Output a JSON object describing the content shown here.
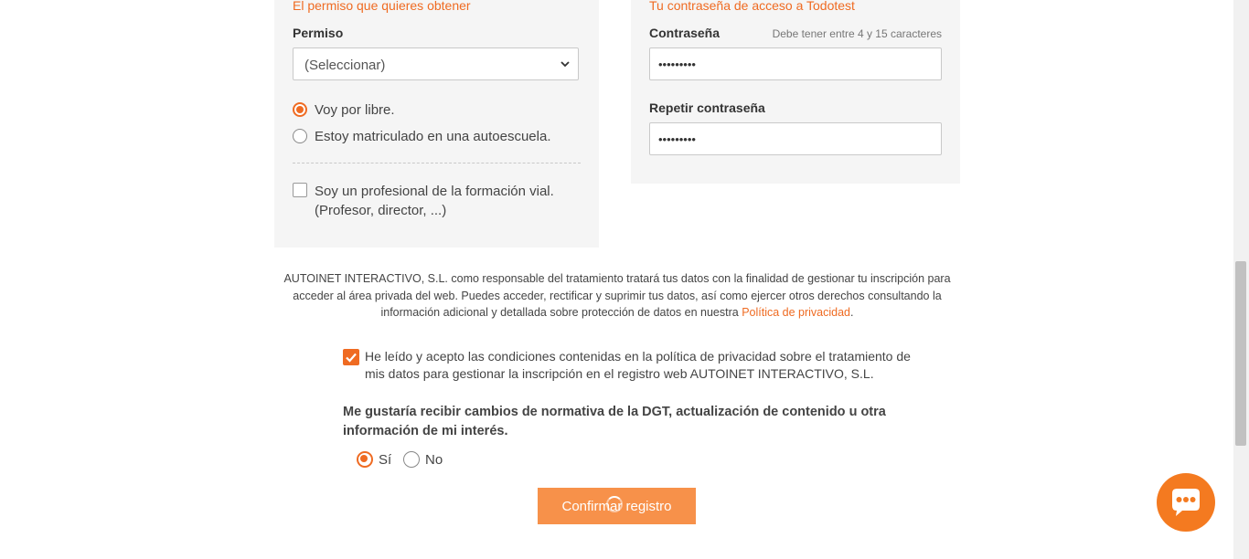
{
  "left_section": {
    "title": "El permiso que quieres obtener",
    "permiso_label": "Permiso",
    "permiso_select_value": "(Seleccionar)",
    "option_libre": "Voy por libre.",
    "option_autoescuela": "Estoy matriculado en una autoescuela.",
    "professional_line1": "Soy un profesional de la formación vial.",
    "professional_line2": "(Profesor, director, ...)"
  },
  "right_section": {
    "title": "Tu contraseña de acceso a Todotest",
    "password_label": "Contraseña",
    "password_hint": "Debe tener entre 4 y 15 caracteres",
    "password_value": "•••••••••",
    "repeat_label": "Repetir contraseña",
    "repeat_value": "•••••••••"
  },
  "privacy": {
    "text": "AUTOINET INTERACTIVO, S.L. como responsable del tratamiento tratará tus datos con la finalidad de gestionar tu inscripción para acceder al área privada del web. Puedes acceder, rectificar y suprimir tus datos, así como ejercer otros derechos consultando la información adicional y detallada sobre protección de datos en nuestra",
    "link": "Política de privacidad",
    "period": "."
  },
  "consent": {
    "text": "He leído y acepto las condiciones contenidas en la política de privacidad sobre el tratamiento de mis datos para gestionar la inscripción en el registro web AUTOINET INTERACTIVO, S.L.",
    "checked": true
  },
  "newsletter": {
    "question": "Me gustaría recibir cambios de normativa de la DGT, actualización de contenido u otra información de mi interés.",
    "yes": "Sí",
    "no": "No"
  },
  "confirm_button": "Confirmar registro",
  "colors": {
    "accent": "#ef6b22",
    "button": "#f7914a",
    "chat": "#f47a20"
  },
  "icons": {
    "select_arrow": "chevron-down-icon",
    "checkmark": "check-icon",
    "chat": "chat-icon",
    "loading": "spinner-icon"
  }
}
